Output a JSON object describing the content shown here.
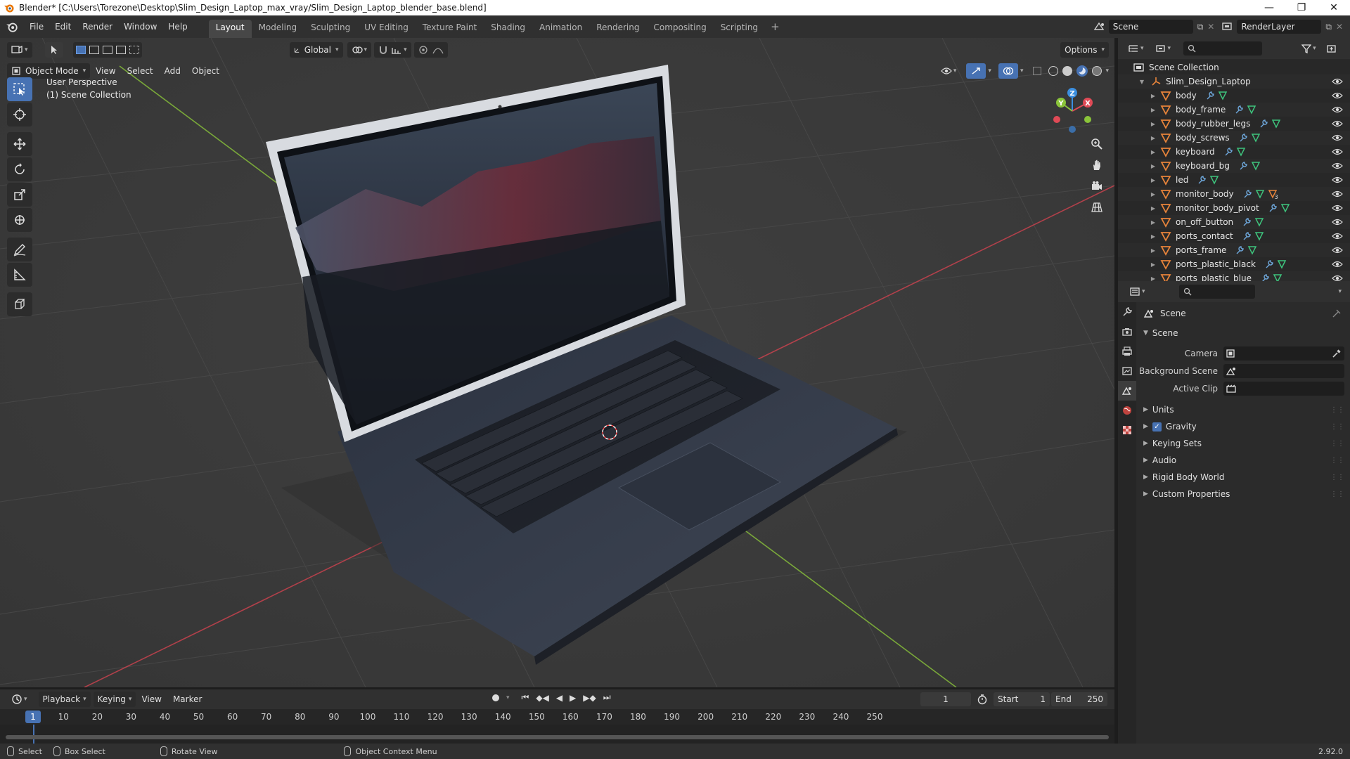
{
  "window": {
    "title": "Blender* [C:\\Users\\Torezone\\Desktop\\Slim_Design_Laptop_max_vray/Slim_Design_Laptop_blender_base.blend]",
    "minimize": "—",
    "maximize": "❐",
    "close": "✕"
  },
  "menu": [
    "File",
    "Edit",
    "Render",
    "Window",
    "Help"
  ],
  "workspaces": [
    "Layout",
    "Modeling",
    "Sculpting",
    "UV Editing",
    "Texture Paint",
    "Shading",
    "Animation",
    "Rendering",
    "Compositing",
    "Scripting"
  ],
  "active_workspace": "Layout",
  "add_workspace": "+",
  "scene_selector": "Scene",
  "view_layer_selector": "RenderLayer",
  "viewport": {
    "mode": "Object Mode",
    "menus": [
      "View",
      "Select",
      "Add",
      "Object"
    ],
    "orientation": "Global",
    "options_label": "Options",
    "perspective_text": "User Perspective",
    "collection_text": "(1) Scene Collection"
  },
  "outliner": {
    "root": "Scene Collection",
    "collection": "Slim_Design_Laptop",
    "items": [
      "body",
      "body_frame",
      "body_rubber_legs",
      "body_screws",
      "keyboard",
      "keyboard_bg",
      "led",
      "monitor_body",
      "monitor_body_pivot",
      "on_off_button",
      "ports_contact",
      "ports_frame",
      "ports_plastic_black",
      "ports_plastic_blue"
    ],
    "monitor_body_badge": "3"
  },
  "properties": {
    "context_title": "Scene",
    "panel_title": "Scene",
    "camera_label": "Camera",
    "background_scene_label": "Background Scene",
    "active_clip_label": "Active Clip",
    "sections": [
      "Units",
      "Gravity",
      "Keying Sets",
      "Audio",
      "Rigid Body World",
      "Custom Properties"
    ],
    "gravity_checked": true
  },
  "timeline": {
    "menus": [
      "Playback",
      "Keying",
      "View",
      "Marker"
    ],
    "current_frame": "1",
    "start_label": "Start",
    "start_value": "1",
    "end_label": "End",
    "end_value": "250",
    "ruler_current": "1",
    "ruler_ticks": [
      "10",
      "20",
      "30",
      "40",
      "50",
      "60",
      "70",
      "80",
      "90",
      "100",
      "110",
      "120",
      "130",
      "140",
      "150",
      "160",
      "170",
      "180",
      "190",
      "200",
      "210",
      "220",
      "230",
      "240",
      "250"
    ]
  },
  "statusbar": {
    "select": "Select",
    "box_select": "Box Select",
    "rotate_view": "Rotate View",
    "context_menu": "Object Context Menu",
    "version": "2.92.0"
  },
  "colors": {
    "accent": "#4772b3",
    "mesh_icon": "#e8843a",
    "modifier_icon": "#6fa8dc",
    "data_icon": "#3ec47d",
    "x_axis": "#e04a56",
    "y_axis": "#8ac43a",
    "z_axis": "#3b8fe0"
  }
}
